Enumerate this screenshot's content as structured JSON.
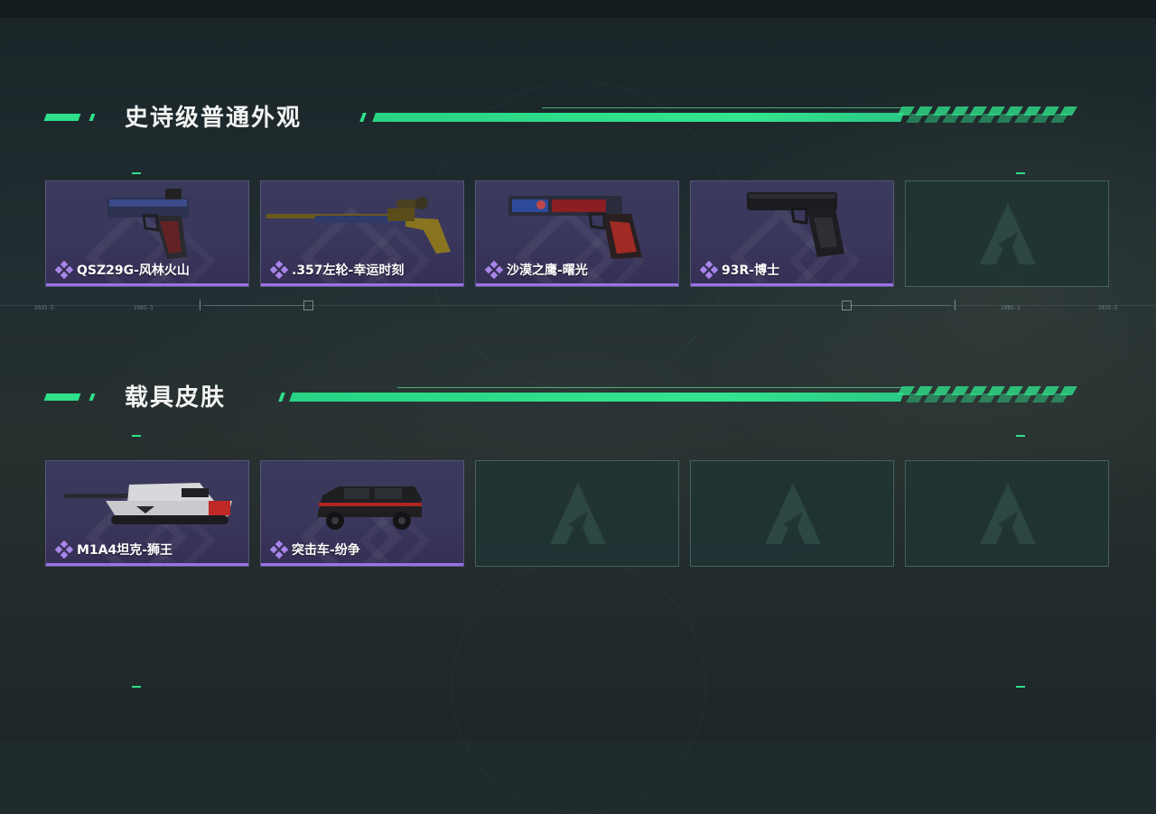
{
  "sections": [
    {
      "title": "史诗级普通外观",
      "items": [
        {
          "name": "QSZ29G-风林火山",
          "art": "pistol-icon"
        },
        {
          "name": ".357左轮-幸运时刻",
          "art": "rifle-icon"
        },
        {
          "name": "沙漠之鹰-曙光",
          "art": "pistol-icon"
        },
        {
          "name": "93R-博士",
          "art": "pistol-icon"
        }
      ],
      "empty_slots": 1
    },
    {
      "title": "载具皮肤",
      "items": [
        {
          "name": "M1A4坦克-狮王",
          "art": "tank-icon"
        },
        {
          "name": "突击车-纷争",
          "art": "truck-icon"
        }
      ],
      "empty_slots": 3
    }
  ],
  "divider_labels": [
    "2035-5",
    "1985-3",
    "1985-3",
    "2035-5"
  ],
  "colors": {
    "accent": "#2ee08a",
    "rarity": "#9b72e6",
    "card_bg": "#3a3a5c"
  }
}
